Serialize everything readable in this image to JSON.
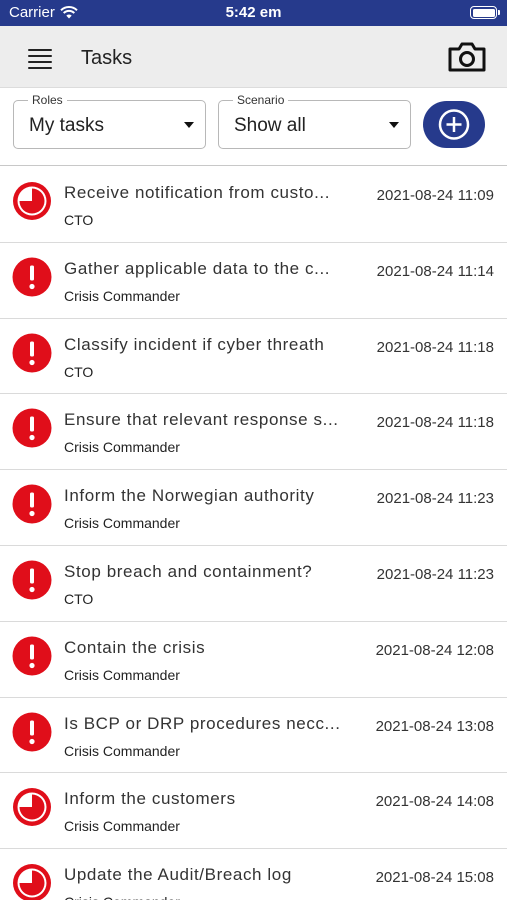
{
  "status_bar": {
    "carrier": "Carrier",
    "time": "5:42 em"
  },
  "header": {
    "title": "Tasks",
    "menu_icon": "hamburger-menu-icon",
    "camera_icon": "camera-icon"
  },
  "filters": {
    "roles": {
      "label": "Roles",
      "value": "My tasks"
    },
    "scenario": {
      "label": "Scenario",
      "value": "Show all"
    },
    "add_icon": "plus-circle-icon"
  },
  "colors": {
    "brand": "#263a8c",
    "alert": "#e00e1a",
    "background": "#ffffff"
  },
  "tasks": [
    {
      "title": "Receive notification from custo...",
      "role": "CTO",
      "time": "2021-08-24 11:09",
      "icon": "clock-icon"
    },
    {
      "title": "Gather applicable data to the c...",
      "role": "Crisis Commander",
      "time": "2021-08-24 11:14",
      "icon": "alert-icon"
    },
    {
      "title": "Classify incident if cyber threath",
      "role": "CTO",
      "time": "2021-08-24 11:18",
      "icon": "alert-icon"
    },
    {
      "title": "Ensure that relevant response s...",
      "role": "Crisis Commander",
      "time": "2021-08-24 11:18",
      "icon": "alert-icon"
    },
    {
      "title": "Inform the Norwegian authority",
      "role": "Crisis Commander",
      "time": "2021-08-24 11:23",
      "icon": "alert-icon"
    },
    {
      "title": "Stop breach and containment?",
      "role": "CTO",
      "time": "2021-08-24 11:23",
      "icon": "alert-icon"
    },
    {
      "title": "Contain the crisis",
      "role": "Crisis Commander",
      "time": "2021-08-24 12:08",
      "icon": "alert-icon"
    },
    {
      "title": "Is BCP or DRP procedures necc...",
      "role": "Crisis Commander",
      "time": "2021-08-24 13:08",
      "icon": "alert-icon"
    },
    {
      "title": "Inform the customers",
      "role": "Crisis Commander",
      "time": "2021-08-24 14:08",
      "icon": "clock-icon"
    },
    {
      "title": "Update the Audit/Breach log",
      "role": "Crisis Commander",
      "time": "2021-08-24 15:08",
      "icon": "clock-icon"
    }
  ]
}
